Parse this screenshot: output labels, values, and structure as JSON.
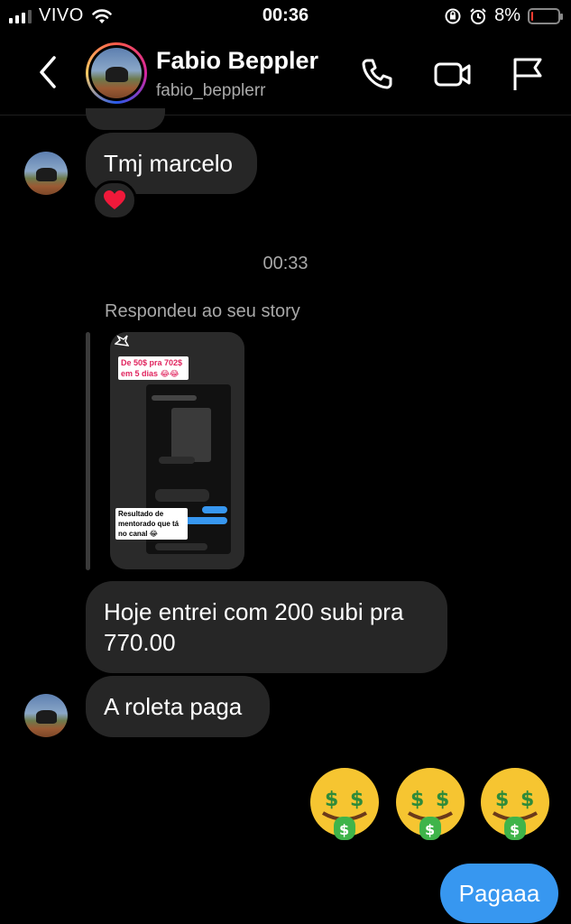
{
  "status": {
    "carrier": "VIVO",
    "time": "00:36",
    "battery_text": "8%",
    "battery_level": 0.08
  },
  "header": {
    "name": "Fabio Beppler",
    "username": "fabio_bepplerr"
  },
  "messages": {
    "m1": "Tmj marcelo",
    "timestamp": "00:33",
    "reply_label": "Respondeu ao seu story",
    "story_top": "De 50$ pra 702$ em 5 dias 😂😂",
    "story_bottom": "Resultado de mentorado que tá no canal 😂",
    "m2": "Hoje entrei com 200 subi pra 770.00",
    "m3": "A roleta paga",
    "sent": "Pagaaa"
  },
  "colors": {
    "sent_bubble": "#3797f0",
    "received_bubble": "#262626"
  }
}
